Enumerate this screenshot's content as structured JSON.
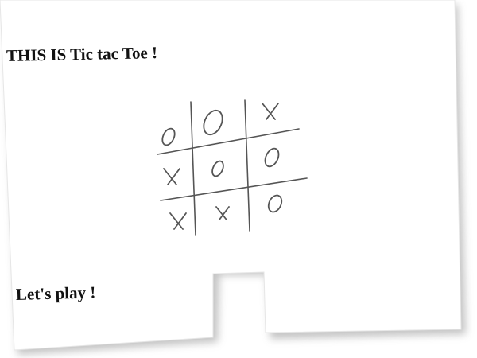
{
  "page": {
    "title": "THIS IS Tic tac Toe !",
    "subtitle": "Let's play !"
  },
  "board": {
    "cells": [
      [
        "O",
        "O",
        "X"
      ],
      [
        "X",
        "O",
        "O"
      ],
      [
        "X",
        "X",
        "O"
      ]
    ]
  },
  "colors": {
    "background": "#ffffff",
    "paper": "#ffffff",
    "shadow": "#bdbdbd",
    "ink": "#222222",
    "sketch": "#555555"
  }
}
